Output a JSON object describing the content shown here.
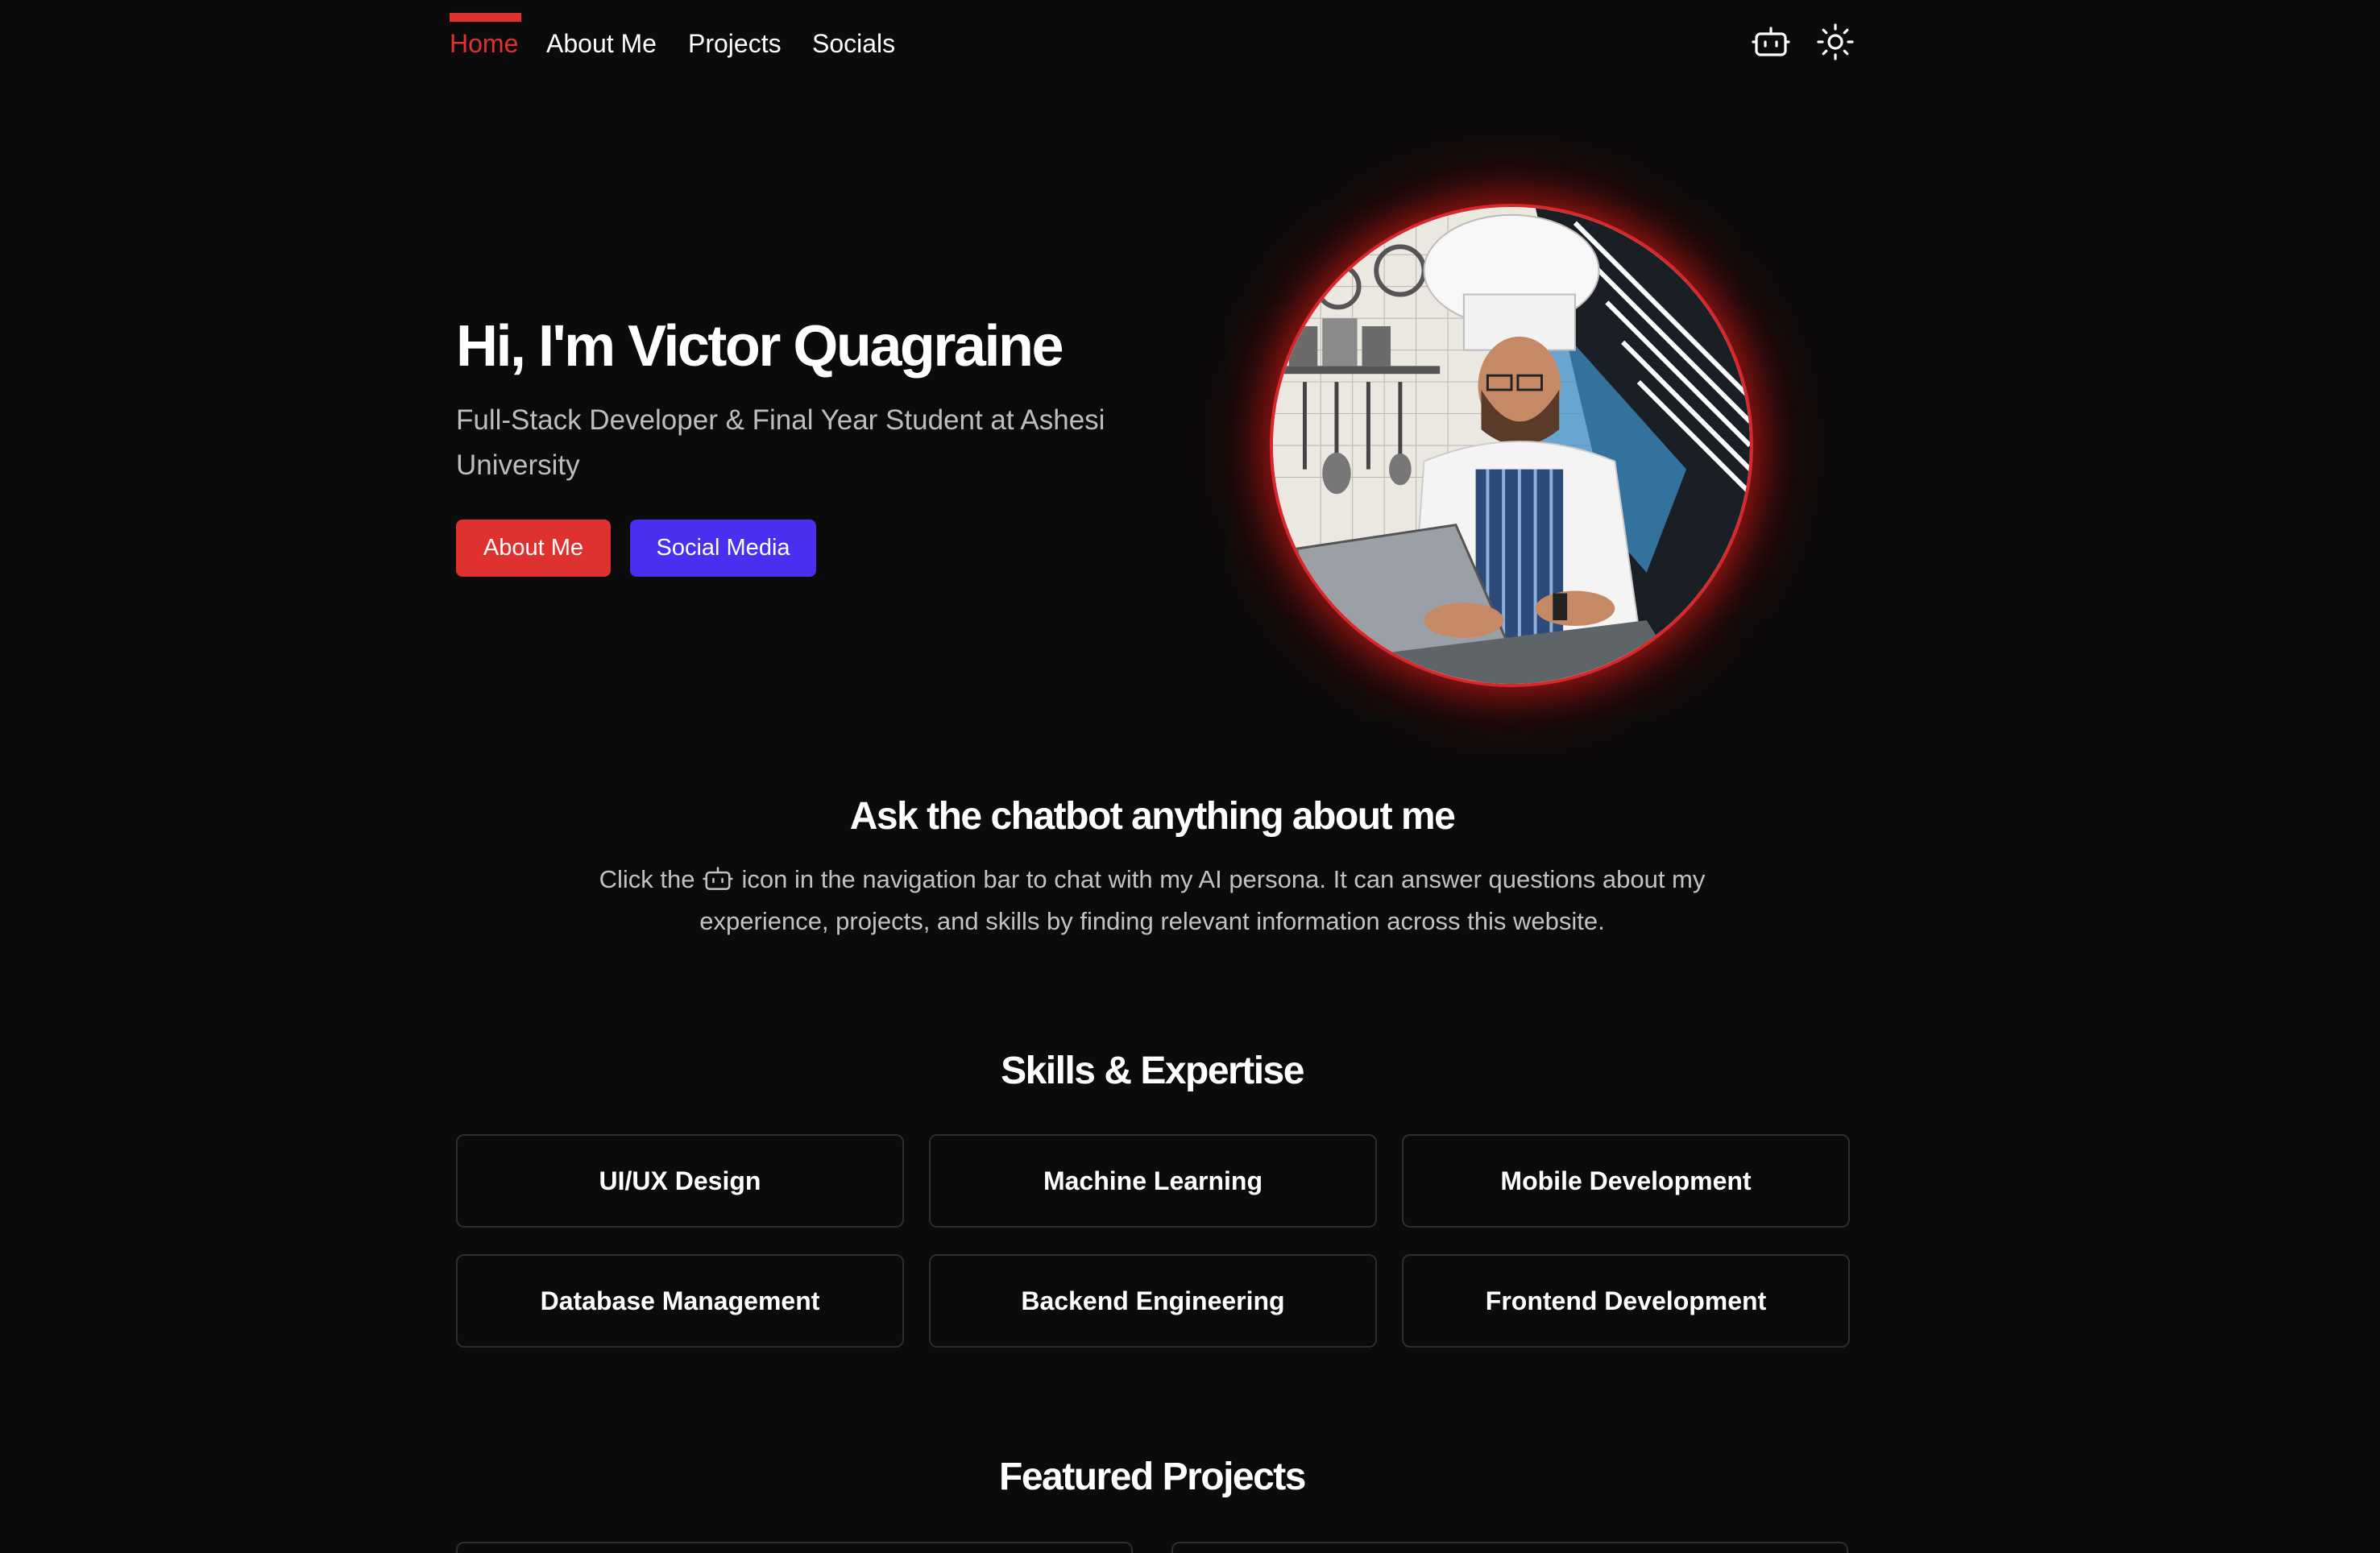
{
  "nav": {
    "links": [
      {
        "label": "Home",
        "active": true
      },
      {
        "label": "About Me",
        "active": false
      },
      {
        "label": "Projects",
        "active": false
      },
      {
        "label": "Socials",
        "active": false
      }
    ],
    "icons": [
      "robot-icon",
      "sun-icon"
    ],
    "accent_color": "#e03131"
  },
  "hero": {
    "title": "Hi, I'm Victor Quagraine",
    "subtitle": "Full-Stack Developer & Final Year Student at Ashesi University",
    "buttons": {
      "about": "About Me",
      "social": "Social Media"
    },
    "button_colors": {
      "about": "#e03131",
      "social": "#4a2ff0"
    },
    "avatar_glow_color": "#d9282b"
  },
  "chatbot": {
    "title": "Ask the chatbot anything about me",
    "desc_before": "Click the",
    "desc_after": "icon in the navigation bar to chat with my AI persona. It can answer questions about my experience, projects, and skills by finding relevant information across this website."
  },
  "skills": {
    "title": "Skills & Expertise",
    "items": [
      "UI/UX Design",
      "Machine Learning",
      "Mobile Development",
      "Database Management",
      "Backend Engineering",
      "Frontend Development"
    ]
  },
  "featured": {
    "title": "Featured Projects"
  },
  "colors": {
    "background": "#0b0b0b",
    "text": "#ffffff",
    "muted_text": "#c2c2c2",
    "card_border": "#2e2e2e"
  }
}
